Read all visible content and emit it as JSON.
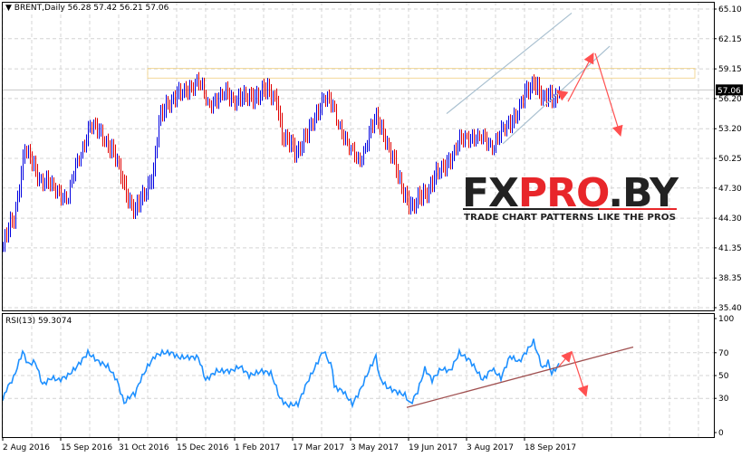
{
  "header": {
    "menu_icon": "triangle-down-icon",
    "symbol": "BRENT,Daily",
    "ohlc": "56.28 57.42 56.21 57.06"
  },
  "rsi_header": "RSI(13) 59.3074",
  "current_price_label": "57.06",
  "logo": {
    "text_part1": "FX",
    "text_part2": "PRO",
    "text_part3": ".BY",
    "tagline": "TRADE CHART PATTERNS LIKE THE PROS"
  },
  "colors": {
    "bull_bar": "#0000e0",
    "bear_bar": "#e00000",
    "rsi_line": "#1e90ff",
    "channel_line": "#a9c0d0",
    "rsi_trendline": "#a05050",
    "arrow": "#ff5050",
    "resistance_zone": "#f0d080",
    "grid": "#d4d4d4"
  },
  "chart_data": [
    {
      "type": "ohlc",
      "title": "BRENT,Daily",
      "x_unit": "bar index (trading days from 2 Aug 2016)",
      "y_ticks": [
        "65.10",
        "62.15",
        "59.15",
        "56.20",
        "53.20",
        "50.25",
        "47.30",
        "44.30",
        "41.35",
        "38.35",
        "35.40"
      ],
      "ylim": [
        35.4,
        65.1
      ],
      "x_ticks": [
        {
          "bar": 0,
          "label": "2 Aug 2016"
        },
        {
          "bar": 32,
          "label": "15 Sep 2016"
        },
        {
          "bar": 64,
          "label": "31 Oct 2016"
        },
        {
          "bar": 96,
          "label": "15 Dec 2016"
        },
        {
          "bar": 128,
          "label": "1 Feb 2017"
        },
        {
          "bar": 160,
          "label": "17 Mar 2017"
        },
        {
          "bar": 192,
          "label": "3 May 2017"
        },
        {
          "bar": 224,
          "label": "19 Jun 2017"
        },
        {
          "bar": 256,
          "label": "3 Aug 2017"
        },
        {
          "bar": 288,
          "label": "18 Sep 2017"
        }
      ],
      "close_anchors": [
        [
          0,
          41.7
        ],
        [
          6,
          44.4
        ],
        [
          12,
          51.3
        ],
        [
          18,
          48.9
        ],
        [
          28,
          47.1
        ],
        [
          36,
          46.2
        ],
        [
          41,
          49.8
        ],
        [
          48,
          53.4
        ],
        [
          56,
          52.5
        ],
        [
          63,
          49.8
        ],
        [
          68,
          47.1
        ],
        [
          73,
          44.8
        ],
        [
          78,
          47.1
        ],
        [
          83,
          48.9
        ],
        [
          86,
          53.8
        ],
        [
          91,
          56.1
        ],
        [
          98,
          56.5
        ],
        [
          107,
          57.9
        ],
        [
          113,
          55.6
        ],
        [
          123,
          56.5
        ],
        [
          133,
          56.1
        ],
        [
          143,
          57.0
        ],
        [
          151,
          56.5
        ],
        [
          154,
          52.5
        ],
        [
          161,
          51.1
        ],
        [
          168,
          52.5
        ],
        [
          177,
          56.5
        ],
        [
          183,
          54.7
        ],
        [
          191,
          51.1
        ],
        [
          196,
          49.8
        ],
        [
          201,
          52.0
        ],
        [
          206,
          54.3
        ],
        [
          211,
          52.5
        ],
        [
          218,
          48.4
        ],
        [
          226,
          45.3
        ],
        [
          233,
          47.1
        ],
        [
          241,
          48.9
        ],
        [
          248,
          50.7
        ],
        [
          256,
          52.5
        ],
        [
          263,
          52.0
        ],
        [
          271,
          51.6
        ],
        [
          278,
          53.4
        ],
        [
          286,
          55.6
        ],
        [
          293,
          58.3
        ],
        [
          298,
          56.1
        ],
        [
          304,
          56.5
        ],
        [
          307,
          57.06
        ]
      ],
      "last_bar": {
        "open": 56.28,
        "high": 57.42,
        "low": 56.21,
        "close": 57.06
      },
      "resistance_zone": [
        57.06,
        59.2
      ],
      "resistance_zone_bars": [
        80,
        382
      ],
      "channel_upper": [
        [
          245,
          54.7
        ],
        [
          314,
          64.7
        ]
      ],
      "channel_lower": [
        [
          276,
          51.7
        ],
        [
          335,
          61.4
        ]
      ],
      "projection_arrows": [
        {
          "from": [
            309,
            56.6
          ],
          "to": [
            306,
            57.0
          ]
        },
        {
          "from": [
            312,
            55.9
          ],
          "to": [
            326,
            60.7
          ]
        },
        {
          "from": [
            327,
            60.7
          ],
          "to": [
            341,
            52.5
          ]
        }
      ]
    },
    {
      "type": "line",
      "title": "RSI(13)",
      "last_value": 59.3074,
      "ylim": [
        0,
        100
      ],
      "y_ticks": [
        "100",
        "70",
        "50",
        "30",
        "0"
      ],
      "levels": [
        30,
        50,
        70
      ],
      "rsi_anchors": [
        [
          0,
          28
        ],
        [
          2,
          38
        ],
        [
          6,
          48
        ],
        [
          11,
          71
        ],
        [
          14,
          60
        ],
        [
          18,
          62
        ],
        [
          22,
          42
        ],
        [
          27,
          48
        ],
        [
          31,
          46
        ],
        [
          36,
          50
        ],
        [
          41,
          58
        ],
        [
          47,
          70
        ],
        [
          53,
          62
        ],
        [
          58,
          58
        ],
        [
          63,
          46
        ],
        [
          67,
          26
        ],
        [
          71,
          33
        ],
        [
          73,
          34
        ],
        [
          76,
          46
        ],
        [
          80,
          58
        ],
        [
          84,
          67
        ],
        [
          88,
          70
        ],
        [
          93,
          70
        ],
        [
          97,
          66
        ],
        [
          103,
          66
        ],
        [
          108,
          66
        ],
        [
          112,
          46
        ],
        [
          118,
          54
        ],
        [
          126,
          54
        ],
        [
          131,
          58
        ],
        [
          136,
          50
        ],
        [
          143,
          54
        ],
        [
          148,
          52
        ],
        [
          150,
          44
        ],
        [
          153,
          30
        ],
        [
          157,
          24
        ],
        [
          163,
          25
        ],
        [
          168,
          44
        ],
        [
          172,
          56
        ],
        [
          177,
          72
        ],
        [
          182,
          56
        ],
        [
          183,
          40
        ],
        [
          188,
          36
        ],
        [
          193,
          25
        ],
        [
          197,
          36
        ],
        [
          202,
          54
        ],
        [
          206,
          67
        ],
        [
          208,
          48
        ],
        [
          212,
          40
        ],
        [
          217,
          36
        ],
        [
          222,
          33
        ],
        [
          225,
          25
        ],
        [
          229,
          36
        ],
        [
          233,
          56
        ],
        [
          237,
          46
        ],
        [
          242,
          56
        ],
        [
          247,
          54
        ],
        [
          252,
          70
        ],
        [
          258,
          63
        ],
        [
          265,
          46
        ],
        [
          270,
          56
        ],
        [
          275,
          48
        ],
        [
          280,
          67
        ],
        [
          285,
          62
        ],
        [
          293,
          80
        ],
        [
          298,
          56
        ],
        [
          301,
          62
        ],
        [
          303,
          52
        ],
        [
          307,
          59.3
        ]
      ],
      "trendline": [
        [
          223,
          22
        ],
        [
          348,
          75
        ]
      ],
      "projection_arrows": [
        {
          "from": [
            307,
            58
          ],
          "to": [
            314,
            71
          ]
        },
        {
          "from": [
            314,
            71
          ],
          "to": [
            322,
            32
          ]
        }
      ]
    }
  ]
}
